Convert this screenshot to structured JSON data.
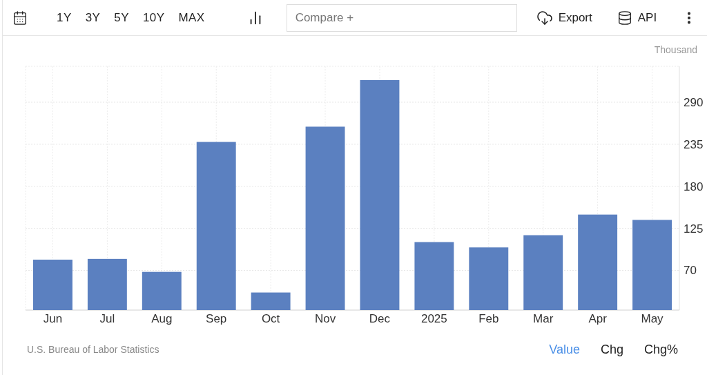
{
  "toolbar": {
    "ranges": [
      "1Y",
      "3Y",
      "5Y",
      "10Y",
      "MAX"
    ],
    "compare": {
      "placeholder": "Compare +"
    },
    "export": "Export",
    "api": "API"
  },
  "chart": {
    "unit": "Thousand",
    "chart_data": {
      "type": "bar",
      "categories": [
        "Jun",
        "Jul",
        "Aug",
        "Sep",
        "Oct",
        "Nov",
        "Dec",
        "2025",
        "Feb",
        "Mar",
        "Apr",
        "May"
      ],
      "grid": true,
      "series": [
        {
          "color": "#5b80c0",
          "values": [
            84,
            85,
            68,
            238,
            41,
            258,
            319,
            107,
            100,
            116,
            143,
            136
          ]
        }
      ],
      "ylim": [
        18,
        337
      ],
      "yticks": [
        70,
        125,
        180,
        235,
        290
      ]
    }
  },
  "footer": {
    "source": "U.S. Bureau of Labor Statistics",
    "views": [
      {
        "label": "Value",
        "selected": true
      },
      {
        "label": "Chg",
        "selected": false
      },
      {
        "label": "Chg%",
        "selected": false
      }
    ]
  }
}
